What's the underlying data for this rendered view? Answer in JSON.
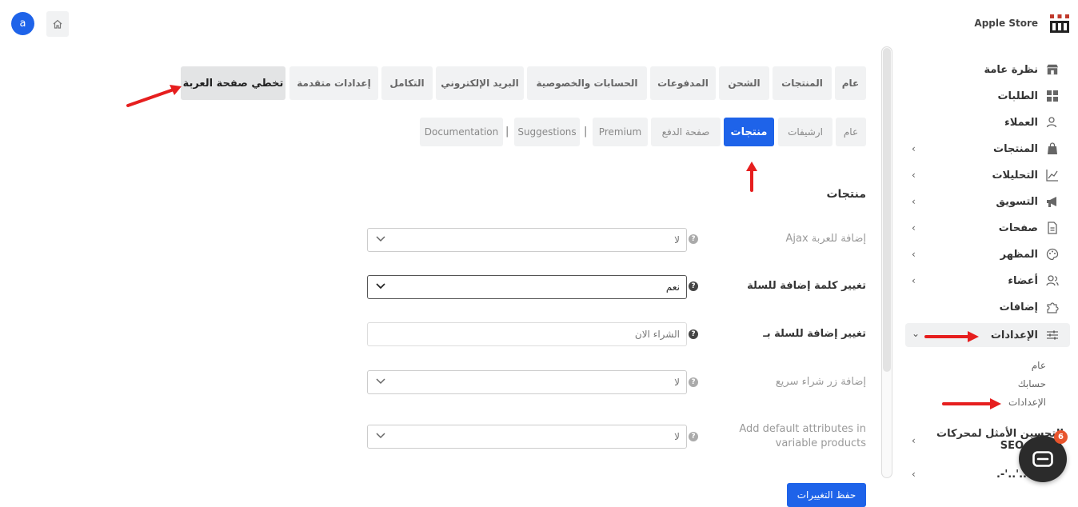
{
  "header": {
    "avatar_letter": "a",
    "store_name": "Apple Store"
  },
  "sidebar": {
    "items": [
      {
        "label": "نظرة عامة",
        "icon": "storefront-icon"
      },
      {
        "label": "الطلبات",
        "icon": "grid-icon"
      },
      {
        "label": "العملاء",
        "icon": "user-icon"
      },
      {
        "label": "المنتجات",
        "icon": "bag-icon"
      },
      {
        "label": "التحليلات",
        "icon": "chart-icon"
      },
      {
        "label": "التسويق",
        "icon": "megaphone-icon"
      },
      {
        "label": "صفحات",
        "icon": "page-icon"
      },
      {
        "label": "المظهر",
        "icon": "palette-icon"
      },
      {
        "label": "أعضاء",
        "icon": "members-icon"
      },
      {
        "label": "إضافات",
        "icon": "puzzle-icon"
      },
      {
        "label": "الإعدادات",
        "icon": "sliders-icon"
      }
    ],
    "sub_items": [
      "عام",
      "حسابك",
      "الإعدادات"
    ],
    "seo_label_line1": "التحسين الأمثل لمحركات",
    "seo_label_line2": "SEO",
    "last_item": ".-'..'.."
  },
  "tabs": [
    "عام",
    "المنتجات",
    "الشحن",
    "المدفوعات",
    "الحسابات والخصوصية",
    "البريد الإلكتروني",
    "التكامل",
    "إعدادات متقدمة",
    "تخطي صفحة العربة"
  ],
  "subtabs": [
    "عام",
    "ارشيفات",
    "منتجات",
    "صفحة الدفع",
    "Premium",
    "Suggestions",
    "Documentation"
  ],
  "subtab_separator": "|",
  "section_title": "منتجات",
  "form": {
    "ajax_label": "إضافة للعربة Ajax",
    "ajax_value": "لا",
    "rename_label": "تغيير كلمة إضافة للسلة",
    "rename_value": "نعم",
    "rename_to_label": "تغيير إضافة للسلة بـ",
    "rename_to_placeholder": "الشراء الان",
    "quick_buy_label": "إضافة زر شراء سريع",
    "quick_buy_value": "لا",
    "default_attr_label_line1": "Add default attributes in",
    "default_attr_label_line2": "variable products",
    "default_attr_value": "لا",
    "help_mark": "?"
  },
  "save_label": "حفظ التغييرات",
  "chat_badge": "6",
  "colors": {
    "accent": "#1e63e9",
    "annotation_arrow": "#e61e1e",
    "badge": "#e8542c"
  }
}
